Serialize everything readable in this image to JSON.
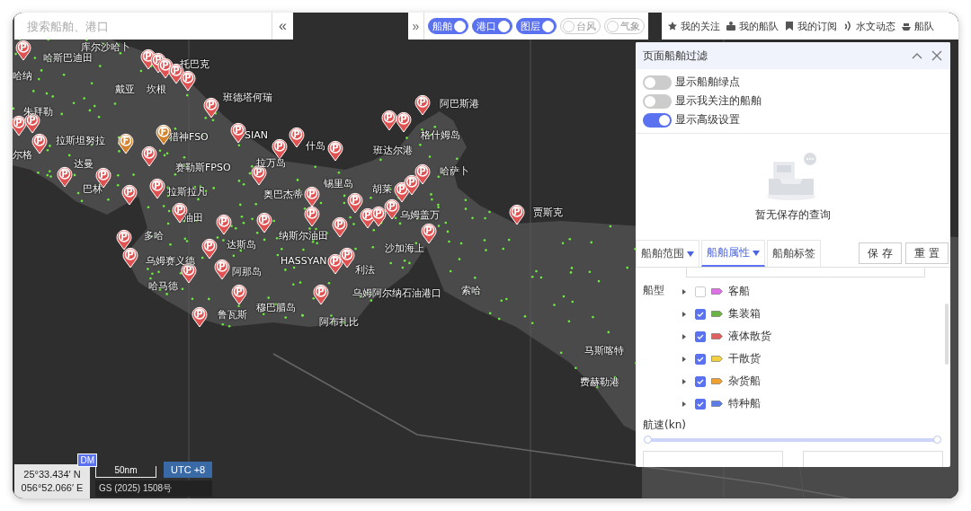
{
  "search": {
    "placeholder": "搜索船舶、港口",
    "collapse": "«"
  },
  "layer_bar": {
    "expand": "»",
    "toggles": [
      {
        "label": "船舶",
        "on": true
      },
      {
        "label": "港口",
        "on": true
      },
      {
        "label": "图层",
        "on": true
      },
      {
        "label": "台风",
        "on": false
      },
      {
        "label": "气象",
        "on": false
      }
    ]
  },
  "nav_links": [
    {
      "label": "我的关注",
      "kind": "star"
    },
    {
      "label": "我的船队",
      "kind": "fleet"
    },
    {
      "label": "我的订阅",
      "kind": "bookmark"
    },
    {
      "label": "水文动态",
      "kind": "wave"
    },
    {
      "label": "船队",
      "kind": "ship"
    }
  ],
  "map_labels": [
    "库尔沙哈卜",
    "哈斯巴迪田",
    "哈纳",
    "托巴克",
    "戴亚",
    "坎根",
    "班德塔何瑞",
    "朱拜勒",
    "拉斯坦努拉",
    "尔格",
    "猎神FSO",
    "赛勒斯FPSO",
    "SIAN",
    "拉万岛",
    "什岛",
    "达曼",
    "巴林",
    "拉斯拉凡",
    "奥巴杰蒂",
    "锡里岛",
    "油田",
    "纳斯尔油田",
    "多哈",
    "达斯岛",
    "乌姆赛义德",
    "阿那岛",
    "HASSYAN",
    "利法",
    "哈马德",
    "鲁瓦斯",
    "穆巴腊岛",
    "乌姆阿尔纳石油港口",
    "阿布扎比",
    "阿巴斯港",
    "格什姆岛",
    "班达尔港",
    "哈萨卜",
    "胡莱",
    "乌姆盖万",
    "沙加海上",
    "贾斯克",
    "索哈",
    "马斯喀特",
    "费赫勒港"
  ],
  "map_pins": [
    {
      "letter": "P",
      "color": "#e05252"
    },
    {
      "letter": "P",
      "color": "#e05252"
    },
    {
      "letter": "P",
      "color": "#e05252"
    },
    {
      "letter": "P",
      "color": "#e05252"
    },
    {
      "letter": "P",
      "color": "#e05252"
    },
    {
      "letter": "P",
      "color": "#e05252"
    },
    {
      "letter": "P",
      "color": "#e05252"
    },
    {
      "letter": "P",
      "color": "#e05252"
    },
    {
      "letter": "P",
      "color": "#e05252"
    },
    {
      "letter": "P",
      "color": "#e05252"
    },
    {
      "letter": "P",
      "color": "#e05252"
    },
    {
      "letter": "P",
      "color": "#e05252"
    },
    {
      "letter": "P",
      "color": "#e05252"
    },
    {
      "letter": "P",
      "color": "#e05252"
    },
    {
      "letter": "F",
      "color": "#d4832c"
    },
    {
      "letter": "P",
      "color": "#e05252"
    },
    {
      "letter": "F",
      "color": "#d4832c"
    },
    {
      "letter": "P",
      "color": "#e05252"
    },
    {
      "letter": "P",
      "color": "#e05252"
    },
    {
      "letter": "P",
      "color": "#e05252"
    },
    {
      "letter": "P",
      "color": "#e05252"
    },
    {
      "letter": "P",
      "color": "#e05252"
    },
    {
      "letter": "P",
      "color": "#e05252"
    },
    {
      "letter": "P",
      "color": "#e05252"
    },
    {
      "letter": "P",
      "color": "#e05252"
    },
    {
      "letter": "P",
      "color": "#e05252"
    },
    {
      "letter": "P",
      "color": "#e05252"
    },
    {
      "letter": "P",
      "color": "#e05252"
    },
    {
      "letter": "P",
      "color": "#e05252"
    },
    {
      "letter": "P",
      "color": "#e05252"
    },
    {
      "letter": "P",
      "color": "#e05252"
    },
    {
      "letter": "P",
      "color": "#e05252"
    },
    {
      "letter": "P",
      "color": "#e05252"
    },
    {
      "letter": "P",
      "color": "#e05252"
    },
    {
      "letter": "P",
      "color": "#e05252"
    },
    {
      "letter": "P",
      "color": "#e05252"
    },
    {
      "letter": "P",
      "color": "#e05252"
    },
    {
      "letter": "P",
      "color": "#e05252"
    },
    {
      "letter": "P",
      "color": "#e05252"
    },
    {
      "letter": "P",
      "color": "#e05252"
    },
    {
      "letter": "P",
      "color": "#e05252"
    },
    {
      "letter": "P",
      "color": "#e05252"
    },
    {
      "letter": "P",
      "color": "#e05252"
    },
    {
      "letter": "P",
      "color": "#e05252"
    },
    {
      "letter": "P",
      "color": "#e05252"
    },
    {
      "letter": "P",
      "color": "#e05252"
    },
    {
      "letter": "P",
      "color": "#e05252"
    },
    {
      "letter": "P",
      "color": "#e05252"
    },
    {
      "letter": "P",
      "color": "#e05252"
    },
    {
      "letter": "P",
      "color": "#e05252"
    }
  ],
  "filter_panel": {
    "title": "页面船舶过滤",
    "switches": [
      {
        "label": "显示船舶绿点",
        "on": false
      },
      {
        "label": "显示我关注的船舶",
        "on": false
      },
      {
        "label": "显示高级设置",
        "on": true
      }
    ],
    "empty_text": "暂无保存的查询",
    "tabs": [
      {
        "label": "船舶范围",
        "selected": false
      },
      {
        "label": "船舶属性",
        "selected": true
      },
      {
        "label": "船舶标签",
        "selected": false
      }
    ],
    "buttons": [
      "保 存",
      "重 置"
    ],
    "ship_type_label": "船型",
    "ship_types": [
      {
        "label": "客船",
        "checked": false,
        "color": "#e070e8"
      },
      {
        "label": "集装箱",
        "checked": true,
        "color": "#6ab344"
      },
      {
        "label": "液体散货",
        "checked": true,
        "color": "#e06060"
      },
      {
        "label": "干散货",
        "checked": true,
        "color": "#f2d040"
      },
      {
        "label": "杂货船",
        "checked": true,
        "color": "#eea030"
      },
      {
        "label": "特种船",
        "checked": true,
        "color": "#5b7ce8"
      }
    ],
    "speed_label": "航速(kn)",
    "speed_slider": {
      "level": 1
    }
  },
  "footer": {
    "lat": "25°33.434′ N",
    "lon": "056°52.066′ E",
    "format": "DM",
    "scale": "50nm",
    "utc": "UTC +8",
    "license": "GS (2025) 1508号"
  }
}
